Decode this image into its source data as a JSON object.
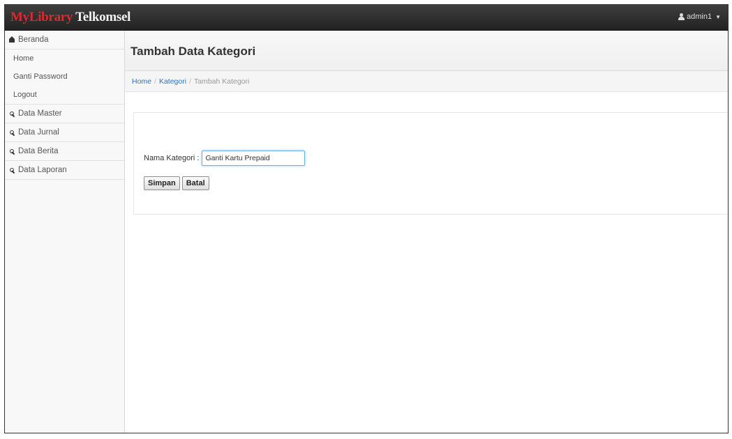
{
  "navbar": {
    "brand_part1": "MyLibrary",
    "brand_part2": "Telkomsel",
    "user_label": "admin1",
    "user_icon": "user-icon",
    "caret_icon": "chevron-down-icon",
    "colors": {
      "brand_red": "#e0262e",
      "navbar_bg": "#2f2f2f"
    }
  },
  "sidebar": {
    "beranda": {
      "label": "Beranda",
      "icon": "home-icon",
      "items": [
        {
          "label": "Home"
        },
        {
          "label": "Ganti Password"
        },
        {
          "label": "Logout"
        }
      ]
    },
    "sections": [
      {
        "label": "Data Master",
        "icon": "wrench-icon"
      },
      {
        "label": "Data Jurnal",
        "icon": "wrench-icon"
      },
      {
        "label": "Data Berita",
        "icon": "wrench-icon"
      },
      {
        "label": "Data Laporan",
        "icon": "wrench-icon"
      }
    ]
  },
  "main": {
    "page_title": "Tambah Data Kategori",
    "breadcrumb": {
      "items": [
        "Home",
        "Kategori"
      ],
      "active": "Tambah Kategori",
      "separator": "/"
    },
    "form": {
      "label": "Nama Kategori :",
      "value": "Ganti Kartu Prepaid",
      "save_label": "Simpan",
      "cancel_label": "Batal"
    },
    "colors": {
      "link": "#2a74c0",
      "input_focus": "#66afe9"
    }
  }
}
